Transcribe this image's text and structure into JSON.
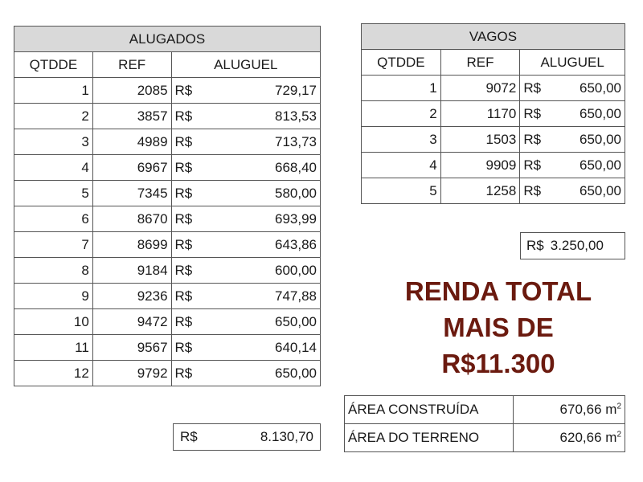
{
  "alugados": {
    "title": "ALUGADOS",
    "headers": [
      "QTDDE",
      "REF",
      "ALUGUEL"
    ],
    "currency": "R$",
    "rows": [
      {
        "qtd": "1",
        "ref": "2085",
        "valor": "729,17"
      },
      {
        "qtd": "2",
        "ref": "3857",
        "valor": "813,53"
      },
      {
        "qtd": "3",
        "ref": "4989",
        "valor": "713,73"
      },
      {
        "qtd": "4",
        "ref": "6967",
        "valor": "668,40"
      },
      {
        "qtd": "5",
        "ref": "7345",
        "valor": "580,00"
      },
      {
        "qtd": "6",
        "ref": "8670",
        "valor": "693,99"
      },
      {
        "qtd": "7",
        "ref": "8699",
        "valor": "643,86"
      },
      {
        "qtd": "8",
        "ref": "9184",
        "valor": "600,00"
      },
      {
        "qtd": "9",
        "ref": "9236",
        "valor": "747,88"
      },
      {
        "qtd": "10",
        "ref": "9472",
        "valor": "650,00"
      },
      {
        "qtd": "11",
        "ref": "9567",
        "valor": "640,14"
      },
      {
        "qtd": "12",
        "ref": "9792",
        "valor": "650,00"
      }
    ],
    "total_currency": "R$",
    "total_value": "8.130,70"
  },
  "vagos": {
    "title": "VAGOS",
    "headers": [
      "QTDDE",
      "REF",
      "ALUGUEL"
    ],
    "currency": "R$",
    "rows": [
      {
        "qtd": "1",
        "ref": "9072",
        "valor": "650,00"
      },
      {
        "qtd": "2",
        "ref": "1170",
        "valor": "650,00"
      },
      {
        "qtd": "3",
        "ref": "1503",
        "valor": "650,00"
      },
      {
        "qtd": "4",
        "ref": "9909",
        "valor": "650,00"
      },
      {
        "qtd": "5",
        "ref": "1258",
        "valor": "650,00"
      }
    ],
    "total_currency": "R$",
    "total_value": "3.250,00"
  },
  "renda": {
    "line1": "RENDA TOTAL",
    "line2": "MAIS DE",
    "line3": "R$11.300"
  },
  "area": {
    "construida_label": "ÁREA CONSTRUÍDA",
    "construida_value": "670,66 m",
    "terreno_label": "ÁREA DO TERRENO",
    "terreno_value": "620,66 m",
    "unit_exp": "2"
  }
}
